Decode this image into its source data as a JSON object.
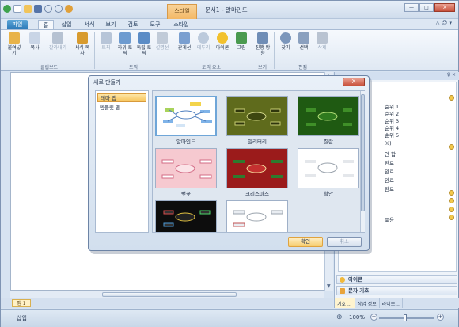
{
  "window": {
    "title": "문서1 - 알마인드",
    "context_tab": "스타일",
    "controls": [
      "—",
      "□",
      "X"
    ]
  },
  "tabs": [
    {
      "label": "파일"
    },
    {
      "label": "홈"
    },
    {
      "label": "삽입"
    },
    {
      "label": "서식"
    },
    {
      "label": "보기"
    },
    {
      "label": "검토"
    },
    {
      "label": "도구"
    },
    {
      "label": "스타일"
    }
  ],
  "tab_right": "△ ☺ ▾",
  "ribbon": {
    "buttons": [
      {
        "label": "붙여넣기",
        "enabled": true,
        "color": "#e8b34a"
      },
      {
        "label": "복사",
        "enabled": true,
        "color": "#c9d5e6"
      },
      {
        "label": "잘라내기",
        "enabled": false,
        "color": "#b6c2d2"
      },
      {
        "label": "서식 복사",
        "enabled": true,
        "color": "#d89b2e"
      },
      {
        "label": "토픽",
        "enabled": false,
        "color": "#b7c5d8"
      },
      {
        "label": "하위 토픽",
        "enabled": true,
        "color": "#6d9bd0"
      },
      {
        "label": "독립 토픽",
        "enabled": true,
        "color": "#5b8cc6"
      },
      {
        "label": "설명선",
        "enabled": false,
        "color": "#c1cbd8"
      },
      {
        "label": "관계선",
        "enabled": true,
        "color": "#7a9fd0"
      },
      {
        "label": "테두리",
        "enabled": false,
        "color": "#bccadc"
      },
      {
        "label": "아이콘",
        "enabled": true,
        "color": "#f2c12e"
      },
      {
        "label": "그림",
        "enabled": true,
        "color": "#4a9a4f"
      },
      {
        "label": "진행 방향",
        "enabled": true,
        "color": "#6f8db6"
      },
      {
        "label": "찾기",
        "enabled": true,
        "color": "#7b96bb"
      },
      {
        "label": "선택",
        "enabled": true,
        "color": "#8aa0bf"
      },
      {
        "label": "삭제",
        "enabled": false,
        "color": "#b9c3d1"
      }
    ],
    "groups": [
      "클립보드",
      "토픽",
      "토픽 요소",
      "보기",
      "편집"
    ]
  },
  "dialog": {
    "title": "새로 만들기",
    "close": "X",
    "categories": [
      {
        "label": "테마 맵",
        "selected": true
      },
      {
        "label": "템플릿 맵",
        "selected": false
      }
    ],
    "templates": [
      {
        "label": "알마인드",
        "bg": "#ffffff",
        "selected": true
      },
      {
        "label": "밀리터리",
        "bg": "#5f6b1c",
        "selected": false
      },
      {
        "label": "질란",
        "bg": "#1f5a12",
        "selected": false
      },
      {
        "label": "벚꽃",
        "bg": "#f6c9d0",
        "selected": false
      },
      {
        "label": "크리스마스",
        "bg": "#9b1b1b",
        "selected": false
      },
      {
        "label": "할안",
        "bg": "#ffffff",
        "selected": false
      },
      {
        "label": "",
        "bg": "#0d0d0d",
        "selected": false
      },
      {
        "label": "",
        "bg": "#ffffff",
        "selected": false
      }
    ],
    "ok": "확인",
    "cancel": "취소"
  },
  "right_panel": {
    "header": "♀ ×",
    "rows": [
      "순위 1",
      "순위 2",
      "순위 3",
      "순위 4",
      "순위 5",
      "%)",
      "안 함",
      "완료",
      "완료",
      "완료",
      "완료",
      "",
      "",
      "",
      "포용"
    ],
    "items": [
      "아이콘",
      "문자 기호"
    ],
    "tabs": [
      {
        "label": "기호 ...",
        "selected": true
      },
      {
        "label": "작업 정보",
        "selected": false
      },
      {
        "label": "라이브...",
        "selected": false
      }
    ]
  },
  "sheet_tab": "맵 1",
  "status": {
    "mode": "삽입",
    "zoom": "100%"
  }
}
